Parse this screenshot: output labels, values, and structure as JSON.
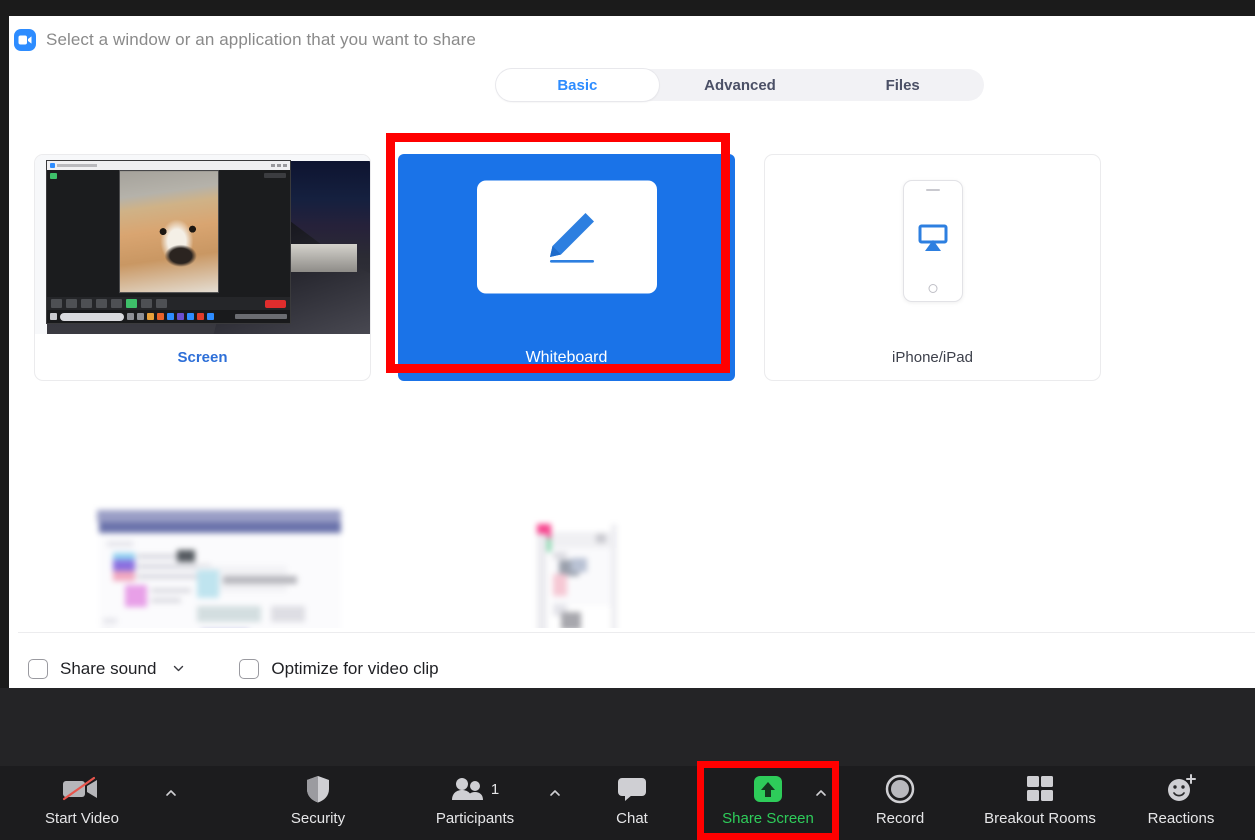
{
  "dialog": {
    "title": "Select a window or an application that you want to share",
    "logo_icon": "zoom-video-icon"
  },
  "tabs": [
    {
      "label": "Basic",
      "active": true
    },
    {
      "label": "Advanced",
      "active": false
    },
    {
      "label": "Files",
      "active": false
    }
  ],
  "cards": [
    {
      "label": "Screen",
      "icon": "desktop-screen-thumbnail",
      "selected": false
    },
    {
      "label": "Whiteboard",
      "icon": "pencil-icon",
      "selected": true
    },
    {
      "label": "iPhone/iPad",
      "icon": "airplay-icon",
      "selected": false
    }
  ],
  "options": {
    "share_sound": {
      "label": "Share sound",
      "checked": false,
      "dropdown_icon": "chevron-down-icon"
    },
    "optimize_video": {
      "label": "Optimize for video clip",
      "checked": false
    }
  },
  "toolbar": [
    {
      "label": "Start Video",
      "icon": "video-off-icon",
      "has_caret": true,
      "highlight": false
    },
    {
      "label": "Security",
      "icon": "shield-icon",
      "has_caret": false,
      "highlight": false
    },
    {
      "label": "Participants",
      "icon": "participants-icon",
      "badge": "1",
      "has_caret": true,
      "highlight": false
    },
    {
      "label": "Chat",
      "icon": "chat-bubble-icon",
      "has_caret": false,
      "highlight": false
    },
    {
      "label": "Share Screen",
      "icon": "share-screen-up-arrow-icon",
      "has_caret": true,
      "highlight": true
    },
    {
      "label": "Record",
      "icon": "record-circle-icon",
      "has_caret": false,
      "highlight": false
    },
    {
      "label": "Breakout Rooms",
      "icon": "grid-squares-icon",
      "has_caret": false,
      "highlight": false
    },
    {
      "label": "Reactions",
      "icon": "smiley-plus-icon",
      "has_caret": false,
      "highlight": false
    }
  ],
  "colors": {
    "accent_blue": "#2d8cff",
    "selected_card_blue": "#1a73e8",
    "highlight_red": "#ff0000",
    "share_green": "#2ecc5a",
    "panel_background": "#ffffff",
    "app_background": "#1b1b1b"
  }
}
